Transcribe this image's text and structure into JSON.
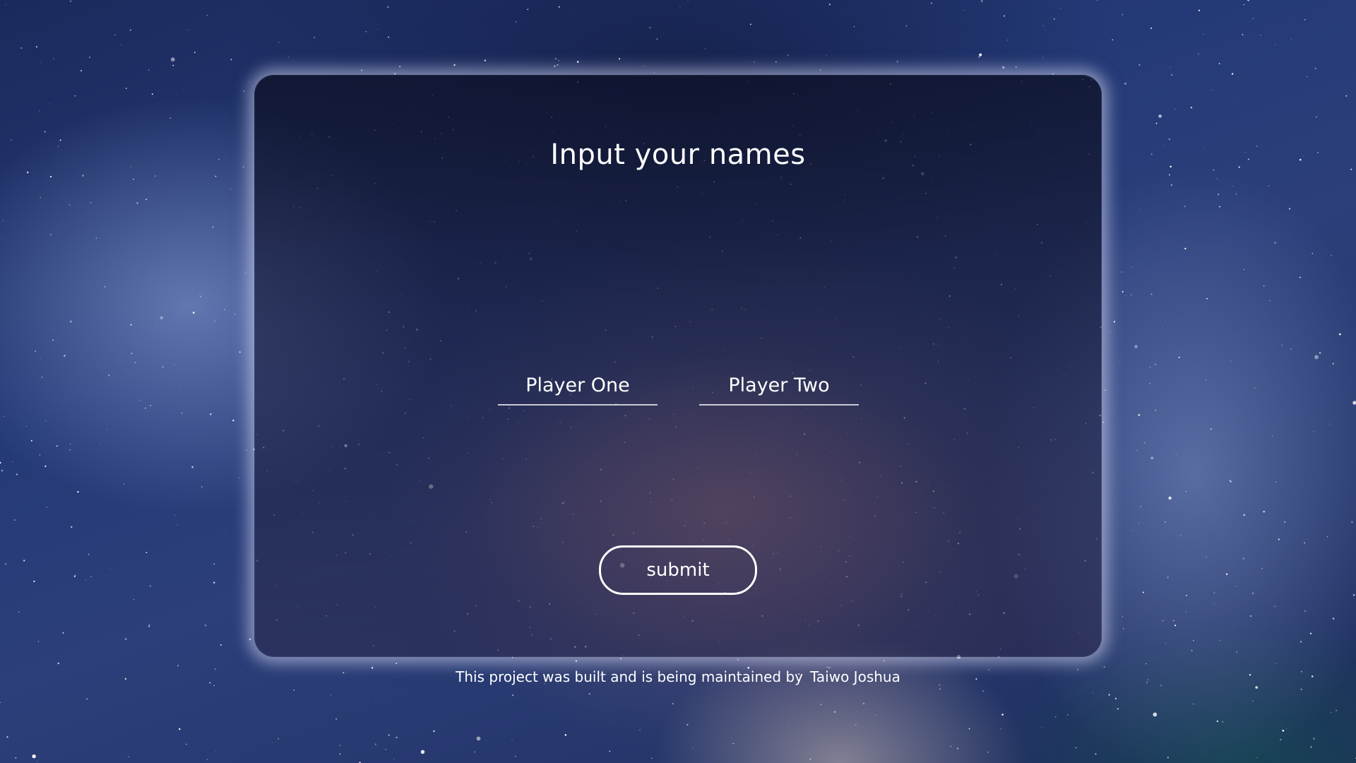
{
  "card": {
    "title": "Input your names"
  },
  "form": {
    "player_one_placeholder": "Player One",
    "player_two_placeholder": "Player Two",
    "submit_label": "submit"
  },
  "footer": {
    "text": "This project was built and is being maintained by",
    "author": "Taiwo Joshua"
  }
}
